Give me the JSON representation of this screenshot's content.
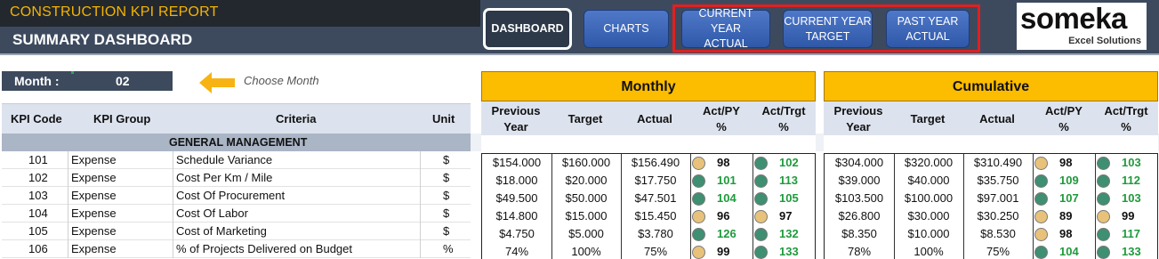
{
  "header": {
    "app_title": "CONSTRUCTION KPI REPORT",
    "page_title": "SUMMARY DASHBOARD",
    "nav": {
      "dashboard": "DASHBOARD",
      "charts": "CHARTS",
      "current_year_actual": [
        "CURRENT YEAR",
        "ACTUAL"
      ],
      "current_year_target": [
        "CURRENT YEAR",
        "TARGET"
      ],
      "past_year_actual": [
        "PAST YEAR",
        "ACTUAL"
      ]
    },
    "logo": {
      "word": "someka",
      "sub": "Excel Solutions"
    }
  },
  "month": {
    "label": "Month :",
    "value": "02",
    "hint": "Choose Month"
  },
  "table": {
    "columns": [
      "KPI Code",
      "KPI Group",
      "Criteria",
      "Unit"
    ],
    "section": "GENERAL MANAGEMENT",
    "rows": [
      {
        "code": "101",
        "group": "Expense",
        "criteria": "Schedule Variance",
        "unit": "$"
      },
      {
        "code": "102",
        "group": "Expense",
        "criteria": "Cost Per Km / Mile",
        "unit": "$"
      },
      {
        "code": "103",
        "group": "Expense",
        "criteria": "Cost Of Procurement",
        "unit": "$"
      },
      {
        "code": "104",
        "group": "Expense",
        "criteria": "Cost Of Labor",
        "unit": "$"
      },
      {
        "code": "105",
        "group": "Expense",
        "criteria": "Cost of Marketing",
        "unit": "$"
      },
      {
        "code": "106",
        "group": "Expense",
        "criteria": "% of Projects Delivered on Budget",
        "unit": "%"
      }
    ]
  },
  "panel_columns": {
    "previous_year": [
      "Previous",
      "Year"
    ],
    "target": "Target",
    "actual": "Actual",
    "act_py": [
      "Act/PY",
      "%"
    ],
    "act_trgt": [
      "Act/Trgt",
      "%"
    ]
  },
  "colors": {
    "good": "#1f9a3c",
    "warn": "#111111",
    "dot_good": "#3f8f72",
    "dot_warn": "#e8c27a"
  },
  "monthly": {
    "title": "Monthly",
    "rows": [
      {
        "py": "$154.000",
        "target": "$160.000",
        "actual": "$156.490",
        "act_py": "98",
        "act_py_status": "warn",
        "act_trgt": "102",
        "act_trgt_status": "good"
      },
      {
        "py": "$18.000",
        "target": "$20.000",
        "actual": "$17.750",
        "act_py": "101",
        "act_py_status": "good",
        "act_trgt": "113",
        "act_trgt_status": "good"
      },
      {
        "py": "$49.500",
        "target": "$50.000",
        "actual": "$47.501",
        "act_py": "104",
        "act_py_status": "good",
        "act_trgt": "105",
        "act_trgt_status": "good"
      },
      {
        "py": "$14.800",
        "target": "$15.000",
        "actual": "$15.450",
        "act_py": "96",
        "act_py_status": "warn",
        "act_trgt": "97",
        "act_trgt_status": "warn"
      },
      {
        "py": "$4.750",
        "target": "$5.000",
        "actual": "$3.780",
        "act_py": "126",
        "act_py_status": "good",
        "act_trgt": "132",
        "act_trgt_status": "good"
      },
      {
        "py": "74%",
        "target": "100%",
        "actual": "75%",
        "act_py": "99",
        "act_py_status": "warn",
        "act_trgt": "133",
        "act_trgt_status": "good"
      }
    ]
  },
  "cumulative": {
    "title": "Cumulative",
    "rows": [
      {
        "py": "$304.000",
        "target": "$320.000",
        "actual": "$310.490",
        "act_py": "98",
        "act_py_status": "warn",
        "act_trgt": "103",
        "act_trgt_status": "good"
      },
      {
        "py": "$39.000",
        "target": "$40.000",
        "actual": "$35.750",
        "act_py": "109",
        "act_py_status": "good",
        "act_trgt": "112",
        "act_trgt_status": "good"
      },
      {
        "py": "$103.500",
        "target": "$100.000",
        "actual": "$97.001",
        "act_py": "107",
        "act_py_status": "good",
        "act_trgt": "103",
        "act_trgt_status": "good"
      },
      {
        "py": "$26.800",
        "target": "$30.000",
        "actual": "$30.250",
        "act_py": "89",
        "act_py_status": "warn",
        "act_trgt": "99",
        "act_trgt_status": "warn"
      },
      {
        "py": "$8.350",
        "target": "$10.000",
        "actual": "$8.530",
        "act_py": "98",
        "act_py_status": "warn",
        "act_trgt": "117",
        "act_trgt_status": "good"
      },
      {
        "py": "78%",
        "target": "100%",
        "actual": "75%",
        "act_py": "104",
        "act_py_status": "good",
        "act_trgt": "133",
        "act_trgt_status": "good"
      }
    ]
  }
}
